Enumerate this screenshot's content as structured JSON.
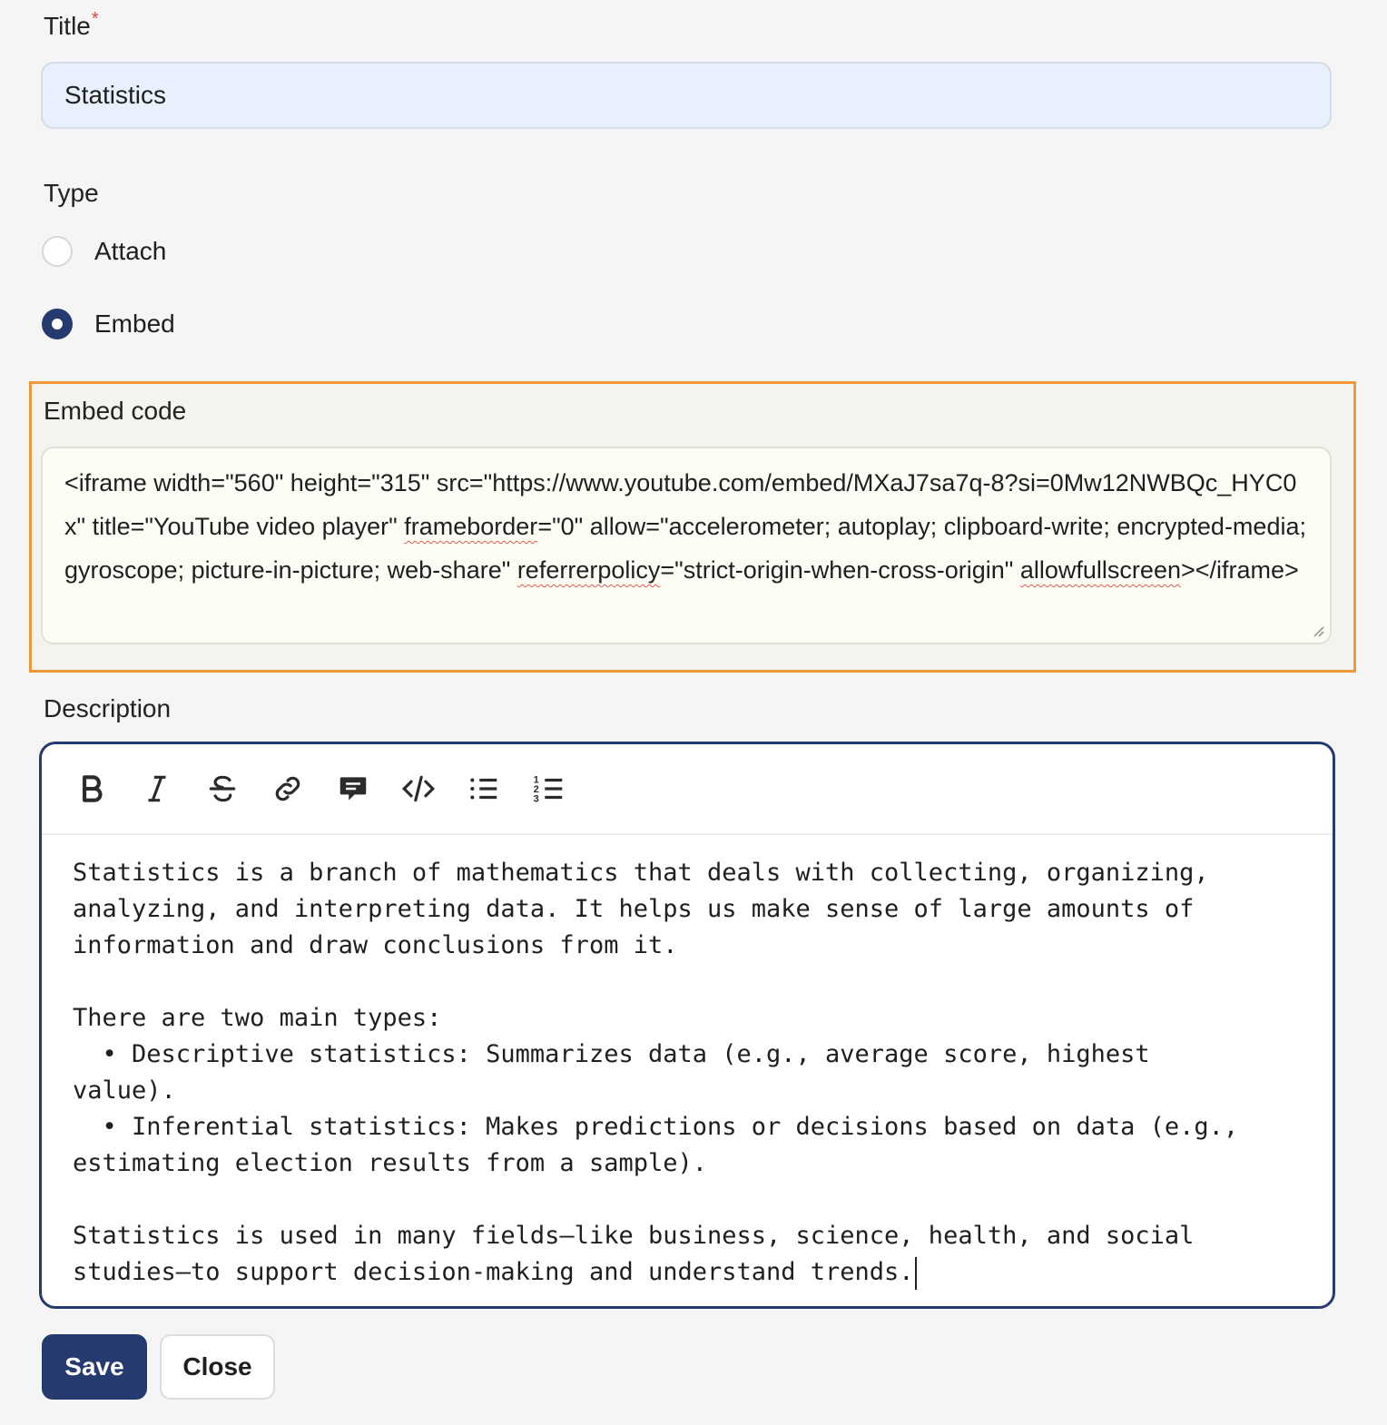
{
  "title_field": {
    "label": "Title",
    "required_mark": "*",
    "value": "Statistics"
  },
  "type_field": {
    "label": "Type",
    "options": [
      {
        "label": "Attach",
        "selected": false
      },
      {
        "label": "Embed",
        "selected": true
      }
    ]
  },
  "embed_field": {
    "label": "Embed code",
    "parts": [
      "<iframe width=\"560\" height=\"315\" src=\"https://www.youtube.com/embed/MXaJ7sa7q-8?si=0Mw12NWBQc_HYC0x\" title=\"YouTube video player\" ",
      "frameborder",
      "=\"0\" allow=\"accelerometer; autoplay; clipboard-write; encrypted-media; gyroscope; picture-in-picture; web-share\" ",
      "referrerpolicy",
      "=\"strict-origin-when-cross-origin\" ",
      "allowfullscreen",
      "></iframe>"
    ]
  },
  "description_field": {
    "label": "Description",
    "toolbar": [
      "bold-icon",
      "italic-icon",
      "strikethrough-icon",
      "link-icon",
      "comment-icon",
      "code-icon",
      "bullet-list-icon",
      "numbered-list-icon"
    ],
    "text": "Statistics is a branch of mathematics that deals with collecting, organizing,\nanalyzing, and interpreting data. It helps us make sense of large amounts of\ninformation and draw conclusions from it.\n\nThere are two main types:\n  • Descriptive statistics: Summarizes data (e.g., average score, highest\nvalue).\n  • Inferential statistics: Makes predictions or decisions based on data (e.g.,\nestimating election results from a sample).\n\nStatistics is used in many fields—like business, science, health, and social\nstudies—to support decision-making and understand trends."
  },
  "actions": {
    "save_label": "Save",
    "close_label": "Close"
  },
  "colors": {
    "primary": "#253a6e",
    "highlight_border": "#f0973a",
    "input_bg": "#e8f0fe",
    "required": "#d9463b"
  }
}
